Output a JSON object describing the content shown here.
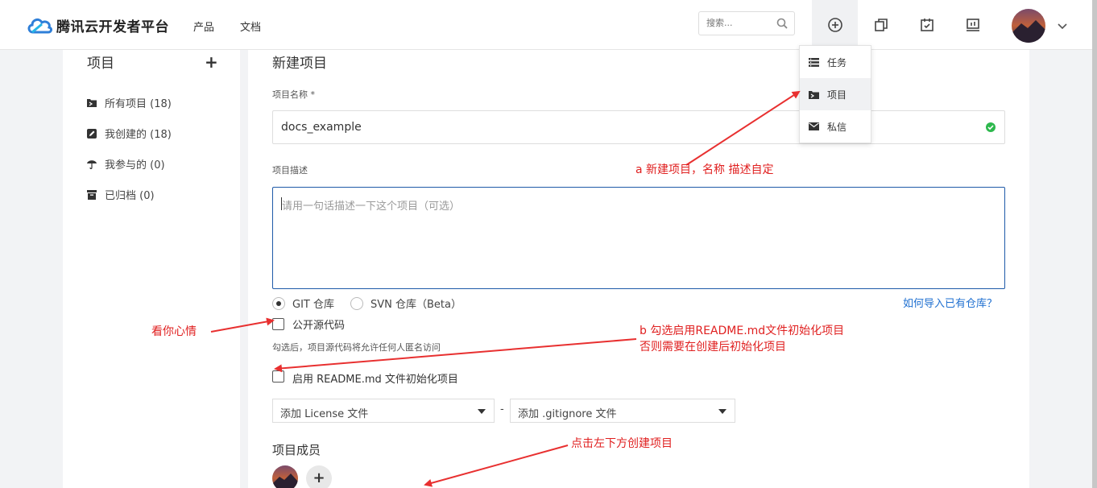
{
  "header": {
    "logo_text": "腾讯云开发者平台",
    "nav": [
      "产品",
      "文档"
    ],
    "search_placeholder": "搜索..."
  },
  "dropdown": {
    "items": [
      {
        "label": "任务",
        "icon": "task-list-icon"
      },
      {
        "label": "项目",
        "icon": "project-folder-icon"
      },
      {
        "label": "私信",
        "icon": "envelope-icon"
      }
    ]
  },
  "sidebar": {
    "title": "项目",
    "add_label": "+",
    "items": [
      {
        "label": "所有项目 (18)",
        "icon": "folder-icon"
      },
      {
        "label": "我创建的 (18)",
        "icon": "edit-icon"
      },
      {
        "label": "我参与的 (0)",
        "icon": "umbrella-icon"
      },
      {
        "label": "已归档 (0)",
        "icon": "archive-icon"
      }
    ]
  },
  "form": {
    "title": "新建项目",
    "name_label": "项目名称 *",
    "name_value": "docs_example",
    "desc_label": "项目描述",
    "desc_placeholder": "请用一句话描述一下这个项目（可选）",
    "repo_git": "GIT 仓库",
    "repo_svn": "SVN 仓库（Beta）",
    "import_link": "如何导入已有仓库？",
    "public_label": "公开源代码",
    "public_hint": "勾选后，项目源代码将允许任何人匿名访问",
    "readme_label": "启用 README.md 文件初始化项目",
    "license_select": "添加 License 文件",
    "separator": "-",
    "gitignore_select": "添加 .gitignore 文件",
    "members_title": "项目成员",
    "add_member": "+"
  },
  "annotations": {
    "a": "a 新建项目，名称 描述自定",
    "mood": "看你心情",
    "b_line1": "b 勾选启用README.md文件初始化项目",
    "b_line2": "否则需要在创建后初始化项目",
    "click": "点击左下方创建项目"
  },
  "colors": {
    "accent_blue": "#1e5aa8",
    "link_blue": "#1e6fd0",
    "annotation_red": "#e02020",
    "success_green": "#2db84d"
  }
}
